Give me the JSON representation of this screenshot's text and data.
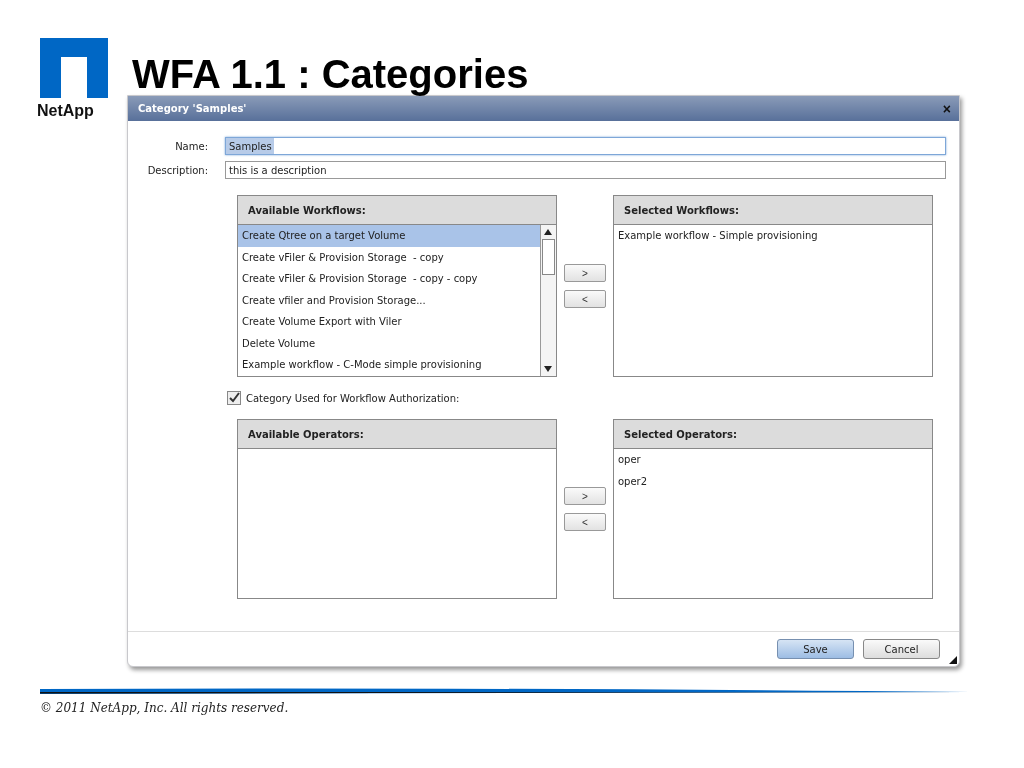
{
  "slide": {
    "title": "WFA 1.1 : Categories",
    "logo_text": "NetApp",
    "footer": "© 2011 NetApp, Inc. All rights reserved."
  },
  "dialog": {
    "title": "Category 'Samples'",
    "close": "×",
    "fields": [
      {
        "label": "Name:",
        "value": "Samples",
        "focused": true
      },
      {
        "label": "Description:",
        "value": "this is a description",
        "focused": false
      }
    ],
    "workflows": {
      "available": {
        "header": "Available Workflows:",
        "items": [
          {
            "label": "Create Qtree on a target Volume",
            "selected": true
          },
          {
            "label": "Create vFiler & Provision Storage  - copy",
            "selected": false
          },
          {
            "label": "Create vFiler & Provision Storage  - copy - copy",
            "selected": false
          },
          {
            "label": "Create vfiler and Provision Storage...",
            "selected": false
          },
          {
            "label": "Create Volume Export with Viler",
            "selected": false
          },
          {
            "label": "Delete Volume",
            "selected": false
          },
          {
            "label": "Example workflow - C-Mode simple provisioning",
            "selected": false
          }
        ]
      },
      "buttons": [
        ">",
        "<"
      ],
      "selected": {
        "header": "Selected Workflows:",
        "items": [
          {
            "label": "Example workflow - Simple provisioning",
            "selected": false
          }
        ]
      }
    },
    "authorization": {
      "label": "Category Used for Workflow Authorization:",
      "checked": true
    },
    "operators": {
      "available": {
        "header": "Available Operators:"
      },
      "buttons": [
        ">",
        "<"
      ],
      "selected": {
        "header": "Selected Operators:",
        "items": [
          {
            "label": "oper",
            "selected": false
          },
          {
            "label": "oper2",
            "selected": false
          }
        ]
      }
    },
    "actions": [
      {
        "label": "Save",
        "kind": "primary"
      },
      {
        "label": "Cancel",
        "kind": "secondary"
      }
    ]
  }
}
